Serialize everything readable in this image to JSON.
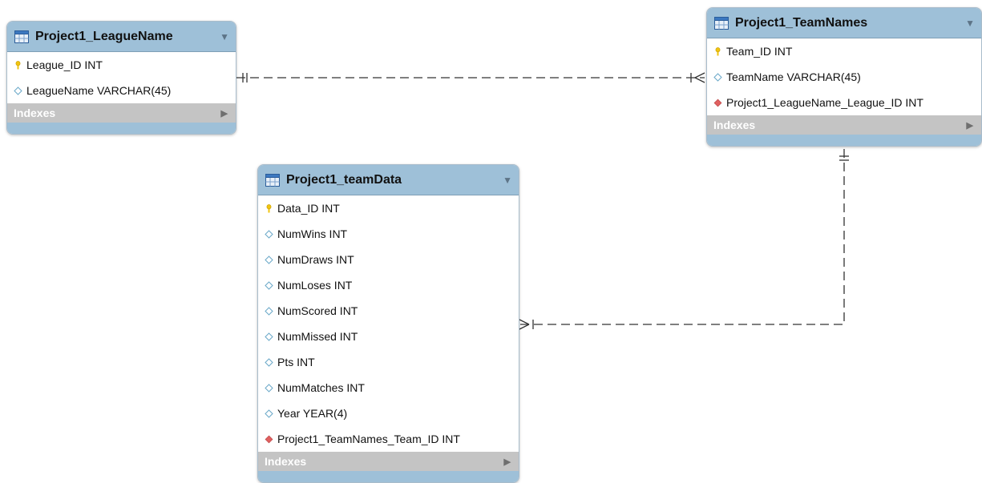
{
  "tables": {
    "league": {
      "title": "Project1_LeagueName",
      "indexes_label": "Indexes",
      "columns": [
        {
          "text": "League_ID INT",
          "kind": "primary-key"
        },
        {
          "text": "LeagueName VARCHAR(45)",
          "kind": "attribute"
        }
      ]
    },
    "teamnames": {
      "title": "Project1_TeamNames",
      "indexes_label": "Indexes",
      "columns": [
        {
          "text": "Team_ID INT",
          "kind": "primary-key"
        },
        {
          "text": "TeamName VARCHAR(45)",
          "kind": "attribute"
        },
        {
          "text": "Project1_LeagueName_League_ID INT",
          "kind": "foreign-key"
        }
      ]
    },
    "teamdata": {
      "title": "Project1_teamData",
      "indexes_label": "Indexes",
      "columns": [
        {
          "text": "Data_ID INT",
          "kind": "primary-key"
        },
        {
          "text": "NumWins INT",
          "kind": "attribute"
        },
        {
          "text": "NumDraws INT",
          "kind": "attribute"
        },
        {
          "text": "NumLoses INT",
          "kind": "attribute"
        },
        {
          "text": "NumScored INT",
          "kind": "attribute"
        },
        {
          "text": "NumMissed INT",
          "kind": "attribute"
        },
        {
          "text": "Pts INT",
          "kind": "attribute"
        },
        {
          "text": "NumMatches INT",
          "kind": "attribute"
        },
        {
          "text": "Year YEAR(4)",
          "kind": "attribute"
        },
        {
          "text": "Project1_TeamNames_Team_ID INT",
          "kind": "foreign-key"
        }
      ]
    }
  },
  "relationships": [
    {
      "from": "Project1_LeagueName",
      "to": "Project1_TeamNames",
      "from_cardinality": "one-and-only-one",
      "to_cardinality": "one-or-many"
    },
    {
      "from": "Project1_TeamNames",
      "to": "Project1_teamData",
      "from_cardinality": "one-and-only-one",
      "to_cardinality": "one-or-many"
    }
  ],
  "colors": {
    "header": "#9ec0d8",
    "indexes_bar": "#c4c4c4",
    "key_icon": "#f1c40f",
    "foreign_key_icon": "#e06060",
    "attribute_icon": "#6aa8c8",
    "connector": "#333333"
  },
  "icons": {
    "table": "table-icon",
    "primary_key": "key-icon",
    "foreign_key": "red-diamond-icon",
    "attribute": "diamond-outline-icon",
    "collapse": "triangle-down-icon",
    "expand": "triangle-right-icon"
  }
}
